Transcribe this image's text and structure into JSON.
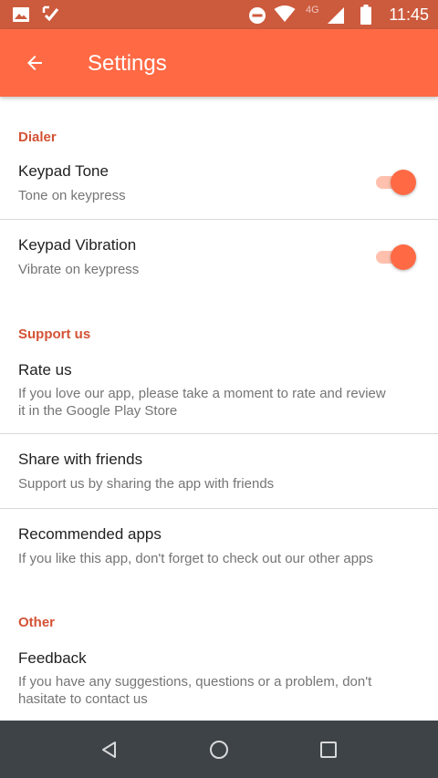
{
  "status_bar": {
    "time": "11:45",
    "network": "4G",
    "icons": [
      "image-icon",
      "check-icon",
      "dnd-icon",
      "wifi-icon",
      "signal-icon",
      "battery-icon"
    ]
  },
  "app_bar": {
    "title": "Settings",
    "back_icon": "arrow-back-icon",
    "color": "#ff6a45"
  },
  "sections": {
    "dialer": {
      "header": "Dialer",
      "items": [
        {
          "title": "Keypad Tone",
          "summary": "Tone on keypress",
          "enabled": true
        },
        {
          "title": "Keypad Vibration",
          "summary": "Vibrate on keypress",
          "enabled": true
        }
      ]
    },
    "support": {
      "header": "Support us",
      "items": [
        {
          "title": "Rate us",
          "summary_lines": [
            "If you love our app, please take a moment to rate and review",
            "it in the Google Play Store"
          ]
        },
        {
          "title": "Share with friends",
          "summary": "Support us by sharing the app with friends"
        },
        {
          "title": "Recommended apps",
          "summary": "If you like this app, don't forget to check out our other apps"
        }
      ]
    },
    "other": {
      "header": "Other",
      "items": [
        {
          "title": "Feedback",
          "summary_lines": [
            "If you have any suggestions, questions or a problem, don't",
            "hasitate to contact us"
          ]
        }
      ]
    }
  },
  "nav_bar": {
    "buttons": [
      "back-triangle-icon",
      "home-circle-icon",
      "recents-square-icon"
    ]
  },
  "colors": {
    "accent": "#ff6a45",
    "status_bar": "#cc5a3d",
    "section_header": "#d35335",
    "nav_bar": "#3e4347"
  }
}
